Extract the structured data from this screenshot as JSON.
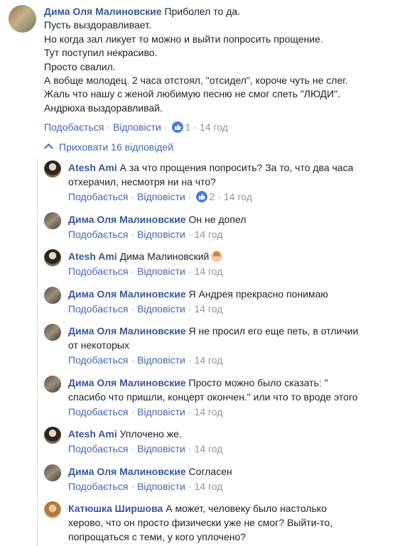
{
  "main_comment": {
    "author": "Дима Оля Малиновские",
    "lines": [
      "Приболел то да.",
      "Пусть выздоравливает.",
      "Но когда зал ликует то можно и выйти попросить прощение.",
      "Тут поступил некрасиво.",
      "Просто свалил.",
      "А вобще молодец. 2 часа отстоял, \"отсидел\", короче чуть не слег.",
      "Жаль что нашу с женой любимую песню не смог спеть \"ЛЮДИ\".",
      "Андрюха выздоравливай."
    ],
    "like_label": "Подобається",
    "reply_label": "Відповісти",
    "reaction_count": "1",
    "time": "14 год"
  },
  "hide_replies_label": "Приховати 16 відповідей",
  "replies": [
    {
      "author": "Atesh Ami",
      "text": "А за что прощения попросить? За то, что два часа",
      "text2": "отхерачил, несмотря ни на что?",
      "like": "Подобається",
      "reply": "Відповісти",
      "reactions": "2",
      "time": "14 год",
      "avatar": "atesh-avatar"
    },
    {
      "author": "Дима Оля Малиновские",
      "text": "Он не допел",
      "like": "Подобається",
      "reply": "Відповісти",
      "time": "14 год",
      "avatar": "dima-avatar"
    },
    {
      "author": "Atesh Ami",
      "text": "Дима Малиновский",
      "like": "Подобається",
      "reply": "Відповісти",
      "time": "14 год",
      "avatar": "atesh-avatar",
      "emoji": "woman-tipping-hand-emoji"
    },
    {
      "author": "Дима Оля Малиновские",
      "text": "Я Андрея прекрасно понимаю",
      "like": "Подобається",
      "reply": "Відповісти",
      "time": "14 год",
      "avatar": "dima-avatar"
    },
    {
      "author": "Дима Оля Малиновские",
      "text": "Я не просил его еще петь, в отличии",
      "text2": "от некоторых",
      "like": "Подобається",
      "reply": "Відповісти",
      "time": "14 год",
      "avatar": "dima-avatar"
    },
    {
      "author": "Дима Оля Малиновские",
      "text": "Просто можно было сказать: \"",
      "text2": "спасибо что пришли, концерт окончен.\" или что то вроде этого",
      "like": "Подобається",
      "reply": "Відповісти",
      "time": "14 год",
      "avatar": "dima-avatar"
    },
    {
      "author": "Atesh Ami",
      "text": "Уплочено же.",
      "like": "Подобається",
      "reply": "Відповісти",
      "time": "14 год",
      "avatar": "atesh-avatar"
    },
    {
      "author": "Дима Оля Малиновские",
      "text": "Согласен",
      "like": "Подобається",
      "reply": "Відповісти",
      "time": "14 год",
      "avatar": "dima-avatar"
    },
    {
      "author": "Катюшка Ширшова",
      "text": "А может, человеку было настолько",
      "text2": "херово, что он просто физически уже не смог? Выйти-то,",
      "text3": "попрощаться с теми, у кого уплочено?",
      "avatar": "katya-avatar"
    }
  ],
  "colors": {
    "link": "#385898",
    "action": "#4267b2",
    "meta": "#90949c",
    "text": "#1d2129",
    "like_badge": "#4c7bd9"
  }
}
